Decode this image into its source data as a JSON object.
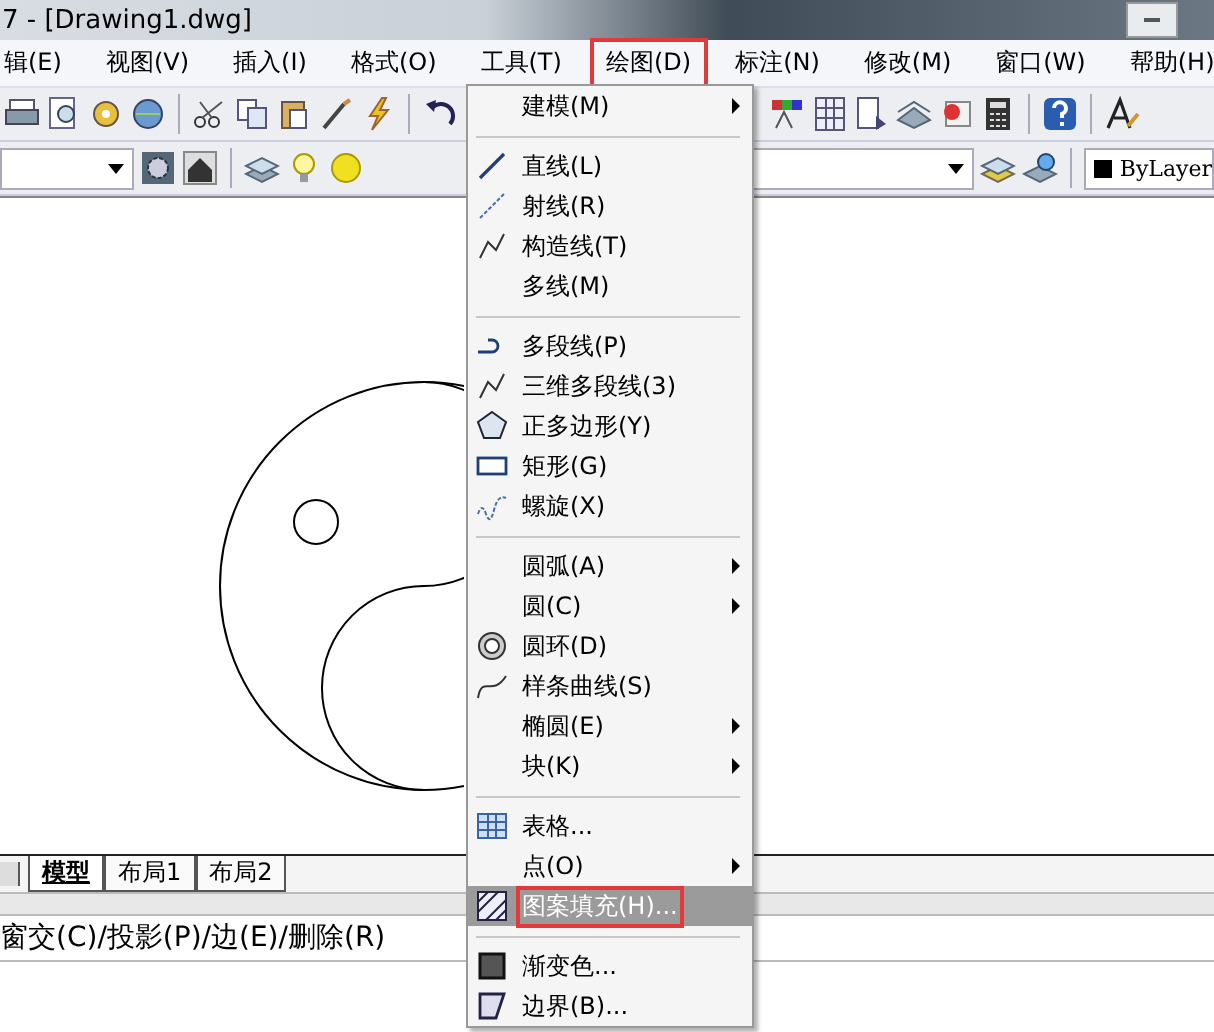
{
  "window": {
    "title": "7 - [Drawing1.dwg]"
  },
  "menu_bar": [
    {
      "label": "辑(E)",
      "selected": false
    },
    {
      "label": "视图(V)",
      "selected": false
    },
    {
      "label": "插入(I)",
      "selected": false
    },
    {
      "label": "格式(O)",
      "selected": false
    },
    {
      "label": "工具(T)",
      "selected": false
    },
    {
      "label": "绘图(D)",
      "selected": true
    },
    {
      "label": "标注(N)",
      "selected": false
    },
    {
      "label": "修改(M)",
      "selected": false
    },
    {
      "label": "窗口(W)",
      "selected": false
    },
    {
      "label": "帮助(H)",
      "selected": false
    }
  ],
  "properties_toolbar": {
    "color_value": "ByLayer"
  },
  "draw_menu": {
    "groups": [
      [
        {
          "label": "建模(M)",
          "submenu": true,
          "selected": false
        }
      ],
      [
        {
          "label": "直线(L)",
          "submenu": false,
          "selected": false
        },
        {
          "label": "射线(R)",
          "submenu": false,
          "selected": false
        },
        {
          "label": "构造线(T)",
          "submenu": false,
          "selected": false
        },
        {
          "label": "多线(M)",
          "submenu": false,
          "selected": false
        }
      ],
      [
        {
          "label": "多段线(P)",
          "submenu": false,
          "selected": false
        },
        {
          "label": "三维多段线(3)",
          "submenu": false,
          "selected": false
        },
        {
          "label": "正多边形(Y)",
          "submenu": false,
          "selected": false
        },
        {
          "label": "矩形(G)",
          "submenu": false,
          "selected": false
        },
        {
          "label": "螺旋(X)",
          "submenu": false,
          "selected": false
        }
      ],
      [
        {
          "label": "圆弧(A)",
          "submenu": true,
          "selected": false
        },
        {
          "label": "圆(C)",
          "submenu": true,
          "selected": false
        },
        {
          "label": "圆环(D)",
          "submenu": false,
          "selected": false
        },
        {
          "label": "样条曲线(S)",
          "submenu": false,
          "selected": false
        },
        {
          "label": "椭圆(E)",
          "submenu": true,
          "selected": false
        },
        {
          "label": "块(K)",
          "submenu": true,
          "selected": false
        }
      ],
      [
        {
          "label": "表格...",
          "submenu": false,
          "selected": false
        },
        {
          "label": "点(O)",
          "submenu": true,
          "selected": false
        },
        {
          "label": "图案填充(H)...",
          "submenu": false,
          "selected": true
        }
      ],
      [
        {
          "label": "渐变色...",
          "submenu": false,
          "selected": false
        },
        {
          "label": "边界(B)...",
          "submenu": false,
          "selected": false
        }
      ]
    ]
  },
  "layout_tabs": [
    {
      "label": "模型",
      "selected": true
    },
    {
      "label": "布局1",
      "selected": false
    },
    {
      "label": "布局2",
      "selected": false
    }
  ],
  "command_line": {
    "text": "窗交(C)/投影(P)/边(E)/删除(R)"
  }
}
